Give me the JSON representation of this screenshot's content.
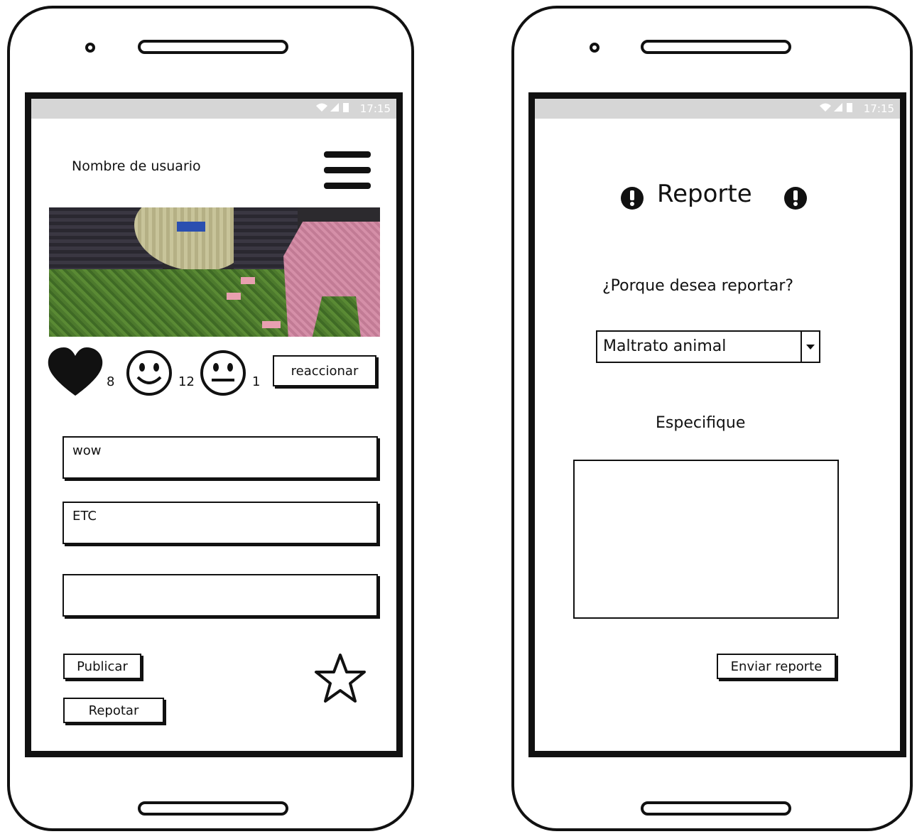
{
  "status_bar": {
    "time": "17:15",
    "icons": "wifi-signal-battery"
  },
  "post_screen": {
    "username": "Nombre de usuario",
    "menu_icon": "hamburger-icon",
    "reactions": [
      {
        "icon": "heart-icon",
        "count": "8"
      },
      {
        "icon": "smile-icon",
        "count": "12"
      },
      {
        "icon": "neutral-face-icon",
        "count": "1"
      }
    ],
    "react_button": "reaccionar",
    "comments": [
      "wow",
      "ETC",
      ""
    ],
    "publish_button": "Publicar",
    "report_button": "Repotar",
    "favorite_icon": "star-icon"
  },
  "report_screen": {
    "title": "Reporte",
    "title_icon": "exclamation-icon",
    "question": "¿Porque desea reportar?",
    "reason_selected": "Maltrato animal",
    "specify_label": "Especifique",
    "details_value": "",
    "submit_button": "Enviar reporte"
  },
  "colors": {
    "ink": "#111111",
    "status_bar": "#d6d6d6",
    "background": "#ffffff"
  }
}
